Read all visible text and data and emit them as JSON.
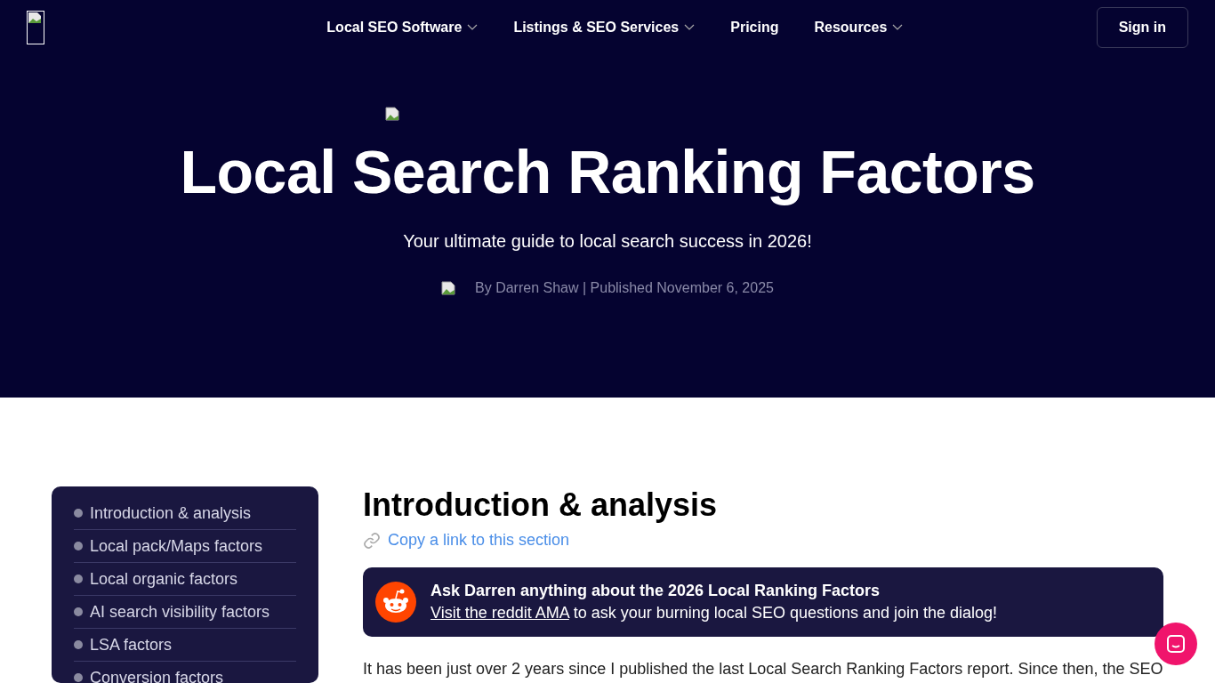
{
  "nav": {
    "links": [
      {
        "label": "Local SEO Software",
        "dropdown": true
      },
      {
        "label": "Listings & SEO Services",
        "dropdown": true
      },
      {
        "label": "Pricing",
        "dropdown": false
      },
      {
        "label": "Resources",
        "dropdown": true
      }
    ],
    "sign_in": "Sign in"
  },
  "hero": {
    "title": "Local Search Ranking Factors",
    "subtitle": "Your ultimate guide to local search success in 2026!",
    "byline": "By Darren Shaw | Published November 6, 2025"
  },
  "toc": {
    "items": [
      "Introduction & analysis",
      "Local pack/Maps factors",
      "Local organic factors",
      "AI search visibility factors",
      "LSA factors",
      "Conversion factors"
    ]
  },
  "article": {
    "heading": "Introduction & analysis",
    "copy_link": "Copy a link to this section",
    "callout": {
      "title": "Ask Darren anything about the 2026 Local Ranking Factors",
      "link": "Visit the reddit AMA",
      "rest": " to ask your burning local SEO questions and join the dialog!"
    },
    "paragraph": "It has been just over 2 years since I published the last Local Search Ranking Factors report. Since then, the SEO"
  }
}
